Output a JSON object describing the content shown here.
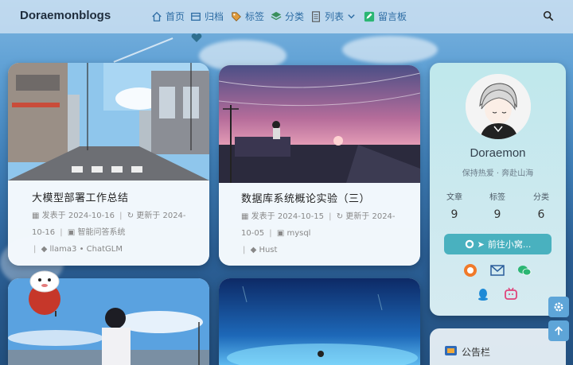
{
  "nav": {
    "brand": "Doraemonblogs",
    "items": [
      {
        "label": "首页",
        "icon": "home-icon"
      },
      {
        "label": "归档",
        "icon": "archive-icon"
      },
      {
        "label": "标签",
        "icon": "tag-icon"
      },
      {
        "label": "分类",
        "icon": "category-icon"
      },
      {
        "label": "列表",
        "icon": "list-icon"
      },
      {
        "label": "留言板",
        "icon": "guestbook-icon"
      }
    ],
    "search_icon": "search-icon"
  },
  "posts": [
    {
      "title": "大模型部署工作总结",
      "posted_label": "发表于",
      "posted": "2024-10-16",
      "updated_label": "更新于",
      "updated": "2024-10-16",
      "category": "智能问答系统",
      "tags": [
        "llama3",
        "ChatGLM"
      ]
    },
    {
      "title": "数据库系统概论实验（三）",
      "posted_label": "发表于",
      "posted": "2024-10-15",
      "updated_label": "更新于",
      "updated": "2024-10-05",
      "category": "mysql",
      "tags": [
        "Hust"
      ]
    }
  ],
  "profile": {
    "name": "Doraemon",
    "description": "保持热爱 · 奔赴山海",
    "stats": [
      {
        "label": "文章",
        "value": "9"
      },
      {
        "label": "标签",
        "value": "9"
      },
      {
        "label": "分类",
        "value": "6"
      }
    ],
    "follow_label": "前往小窝...",
    "social_icons": [
      "github-icon",
      "mail-icon",
      "wechat-icon",
      "qq-icon",
      "bilibili-icon"
    ]
  },
  "notice": {
    "title": "公告栏"
  },
  "colors": {
    "accent": "#49b1bf",
    "nav_link": "#2e6da4"
  }
}
